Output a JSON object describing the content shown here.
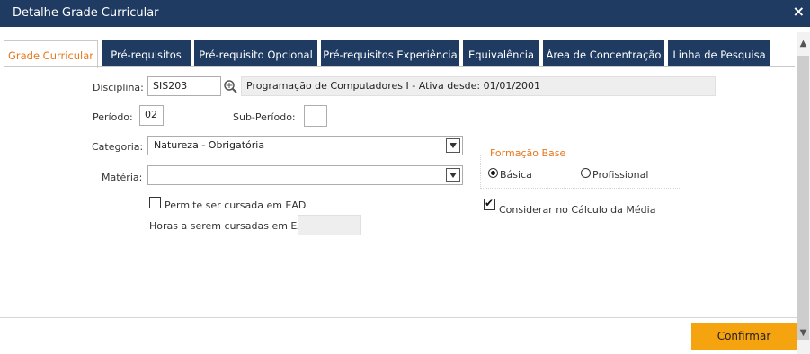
{
  "window": {
    "title": "Detalhe Grade Curricular",
    "close_icon": "×"
  },
  "tabs": [
    {
      "label": "Grade Curricular",
      "active": true
    },
    {
      "label": "Pré-requisitos"
    },
    {
      "label": "Pré-requisito Opcional"
    },
    {
      "label": "Pré-requisitos Experiência"
    },
    {
      "label": "Equivalência"
    },
    {
      "label": "Área de Concentração"
    },
    {
      "label": "Linha de Pesquisa"
    }
  ],
  "form": {
    "disciplina_label": "Disciplina:",
    "disciplina_code": "SIS203",
    "disciplina_desc": "Programação de Computadores I - Ativa desde: 01/01/2001",
    "periodo_label": "Período:",
    "periodo_value": "02",
    "subperiodo_label": "Sub-Período:",
    "subperiodo_value": "",
    "categoria_label": "Categoria:",
    "categoria_value": "Natureza - Obrigatória",
    "materia_label": "Matéria:",
    "materia_value": "",
    "ead_label": "Permite ser cursada em EAD",
    "ead_checked": false,
    "horas_ead_label": "Horas a serem cursadas em EAD:",
    "horas_ead_value": ""
  },
  "formacao": {
    "legend": "Formação Base",
    "options": [
      {
        "label": "Básica",
        "selected": true
      },
      {
        "label": "Profissional",
        "selected": false
      }
    ]
  },
  "media": {
    "label": "Considerar no Cálculo da Média",
    "checked": true
  },
  "footer": {
    "confirm_label": "Confirmar"
  },
  "colors": {
    "titlebar": "#1f3b62",
    "accent": "#e8761a",
    "confirm": "#f5a30f"
  },
  "icons": {
    "lookup": "search-icon",
    "checkmark": "✔"
  }
}
